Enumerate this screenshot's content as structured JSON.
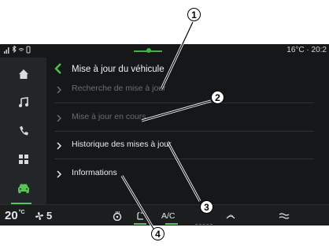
{
  "status_bar": {
    "icons": [
      "signal-icon",
      "bluetooth-icon",
      "wifi-icon",
      "phone-icon"
    ],
    "temperature": "16°C · 20:2"
  },
  "sidebar": {
    "items": [
      {
        "name": "home-icon",
        "active": false
      },
      {
        "name": "music-icon",
        "active": false
      },
      {
        "name": "phone-icon",
        "active": false
      },
      {
        "name": "apps-icon",
        "active": false
      },
      {
        "name": "car-icon",
        "active": true
      }
    ]
  },
  "header": {
    "title": "Mise à jour du véhicule"
  },
  "menu": {
    "items": [
      {
        "label": "Recherche de mise à jour",
        "enabled": false
      },
      {
        "label": "Mise à jour en cours",
        "enabled": false
      },
      {
        "label": "Historique des mises à jour",
        "enabled": true
      },
      {
        "label": "Informations",
        "enabled": true
      }
    ]
  },
  "bottom_bar": {
    "temperature_value": "20",
    "temperature_unit": "°C",
    "fan_speed": "5",
    "ac_label": "A/C"
  },
  "callouts": [
    "1",
    "2",
    "3",
    "4"
  ],
  "colors": {
    "accent": "#57c35a",
    "screen_bg": "#151718",
    "sidebar_bg": "#232628"
  }
}
